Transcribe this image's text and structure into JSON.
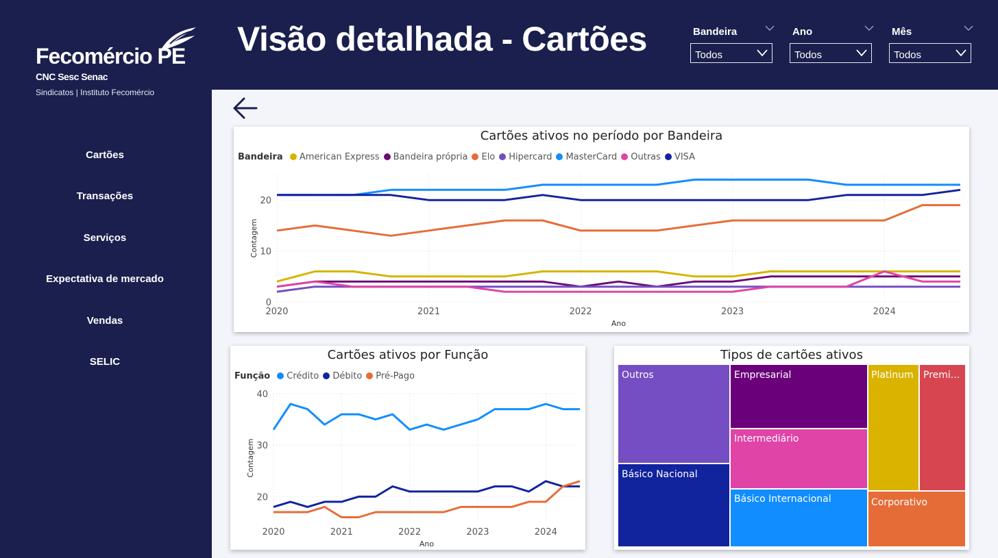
{
  "brand": {
    "name": "Fecomércio PE",
    "sub1": "CNC Sesc Senac",
    "sub2": "Sindicatos | Instituto Fecomércio"
  },
  "page_title": "Visão detalhada - Cartões",
  "filters": [
    {
      "label": "Bandeira",
      "value": "Todos"
    },
    {
      "label": "Ano",
      "value": "Todos"
    },
    {
      "label": "Mês",
      "value": "Todos"
    }
  ],
  "nav": [
    "Cartões",
    "Transações",
    "Serviços",
    "Expectativa de mercado",
    "Vendas",
    "SELIC"
  ],
  "charts": {
    "bandeira": {
      "title": "Cartões ativos no período por Bandeira",
      "legend_title": "Bandeira",
      "xlabel": "Ano",
      "ylabel": "Contagem"
    },
    "funcao": {
      "title": "Cartões ativos por Função",
      "legend_title": "Função",
      "xlabel": "Ano",
      "ylabel": "Contagem"
    },
    "tipos": {
      "title": "Tipos de cartões ativos"
    }
  },
  "chart_data": [
    {
      "type": "line",
      "title": "Cartões ativos no período por Bandeira",
      "xlabel": "Ano",
      "ylabel": "Contagem",
      "xlim": [
        2020,
        2024.5
      ],
      "ylim": [
        0,
        25
      ],
      "xticks": [
        2020,
        2021,
        2022,
        2023,
        2024
      ],
      "yticks": [
        0,
        10,
        20
      ],
      "grid": true,
      "legend_position": "top-left",
      "x": [
        2020,
        2020.25,
        2020.5,
        2020.75,
        2021,
        2021.25,
        2021.5,
        2021.75,
        2022,
        2022.25,
        2022.5,
        2022.75,
        2023,
        2023.25,
        2023.5,
        2023.75,
        2024,
        2024.25,
        2024.5
      ],
      "series": [
        {
          "name": "American Express",
          "color": "#d4b400",
          "values": [
            4,
            6,
            6,
            5,
            5,
            5,
            5,
            6,
            6,
            6,
            6,
            5,
            5,
            6,
            6,
            6,
            6,
            6,
            6
          ]
        },
        {
          "name": "Bandeira própria",
          "color": "#6b0a78",
          "values": [
            3,
            4,
            4,
            4,
            4,
            4,
            4,
            4,
            3,
            4,
            3,
            4,
            4,
            5,
            5,
            5,
            5,
            5,
            5
          ]
        },
        {
          "name": "Elo",
          "color": "#e66c37",
          "values": [
            14,
            15,
            14,
            13,
            14,
            15,
            16,
            16,
            14,
            14,
            14,
            15,
            16,
            16,
            16,
            16,
            16,
            19,
            19
          ]
        },
        {
          "name": "Hipercard",
          "color": "#744ec2",
          "values": [
            2,
            3,
            3,
            3,
            3,
            3,
            3,
            3,
            3,
            3,
            3,
            3,
            3,
            3,
            3,
            3,
            3,
            3,
            3
          ]
        },
        {
          "name": "MasterCard",
          "color": "#118dff",
          "values": [
            21,
            21,
            21,
            22,
            22,
            22,
            22,
            23,
            23,
            23,
            23,
            24,
            24,
            24,
            24,
            23,
            23,
            23,
            23
          ]
        },
        {
          "name": "Outras",
          "color": "#e044a7",
          "values": [
            3,
            4,
            3,
            3,
            3,
            3,
            2,
            2,
            2,
            2,
            2,
            2,
            2,
            3,
            3,
            3,
            6,
            4,
            4
          ]
        },
        {
          "name": "VISA",
          "color": "#12239e",
          "values": [
            21,
            21,
            21,
            21,
            20,
            20,
            20,
            21,
            20,
            20,
            20,
            20,
            20,
            20,
            20,
            21,
            21,
            21,
            22
          ]
        }
      ]
    },
    {
      "type": "line",
      "title": "Cartões ativos por Função",
      "xlabel": "Ano",
      "ylabel": "Contagem",
      "xlim": [
        2020,
        2024.5
      ],
      "ylim": [
        15,
        40
      ],
      "xticks": [
        2020,
        2021,
        2022,
        2023,
        2024
      ],
      "yticks": [
        20,
        30,
        40
      ],
      "grid": true,
      "legend_position": "top-left",
      "x": [
        2020,
        2020.25,
        2020.5,
        2020.75,
        2021,
        2021.25,
        2021.5,
        2021.75,
        2022,
        2022.25,
        2022.5,
        2022.75,
        2023,
        2023.25,
        2023.5,
        2023.75,
        2024,
        2024.25,
        2024.5
      ],
      "series": [
        {
          "name": "Crédito",
          "color": "#118dff",
          "values": [
            33,
            38,
            37,
            34,
            36,
            36,
            35,
            36,
            33,
            34,
            33,
            34,
            35,
            37,
            37,
            37,
            38,
            37,
            37
          ]
        },
        {
          "name": "Débito",
          "color": "#12239e",
          "values": [
            18,
            19,
            18,
            19,
            19,
            20,
            20,
            22,
            21,
            21,
            21,
            21,
            21,
            22,
            22,
            21,
            23,
            22,
            22
          ]
        },
        {
          "name": "Pré-Pago",
          "color": "#e66c37",
          "values": [
            17,
            17,
            17,
            18,
            16,
            16,
            17,
            17,
            17,
            17,
            17,
            18,
            18,
            18,
            18,
            19,
            19,
            22,
            23
          ]
        }
      ]
    },
    {
      "type": "treemap",
      "title": "Tipos de cartões ativos",
      "items": [
        {
          "name": "Outros",
          "color": "#744ec2"
        },
        {
          "name": "Básico Nacional",
          "color": "#12239e"
        },
        {
          "name": "Empresarial",
          "color": "#6b007b"
        },
        {
          "name": "Intermediário",
          "color": "#e044a7"
        },
        {
          "name": "Básico Internacional",
          "color": "#118dff"
        },
        {
          "name": "Platinum",
          "color": "#d9b300"
        },
        {
          "name": "Corporativo",
          "color": "#e66c37"
        },
        {
          "name": "Premi...",
          "color": "#d64550"
        }
      ]
    }
  ]
}
